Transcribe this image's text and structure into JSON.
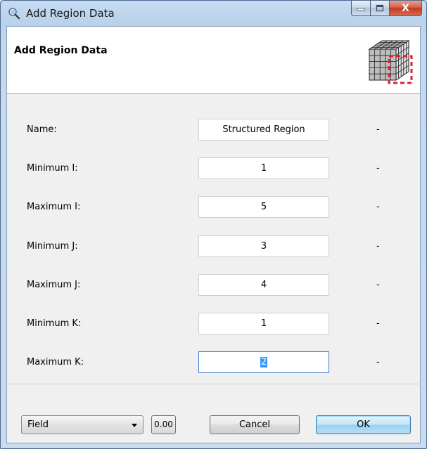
{
  "window": {
    "title": "Add Region Data",
    "icon": "app-magnifier-icon",
    "minimize_glyph": "—",
    "maximize_glyph": "▫",
    "close_glyph": "X"
  },
  "banner": {
    "heading": "Add Region Data",
    "image": "structured-grid-cube-icon"
  },
  "form": {
    "rows": [
      {
        "label": "Name:",
        "value": "Structured Region",
        "suffix": "-"
      },
      {
        "label": "Minimum I:",
        "value": "1",
        "suffix": "-"
      },
      {
        "label": "Maximum I:",
        "value": "5",
        "suffix": "-"
      },
      {
        "label": "Minimum J:",
        "value": "3",
        "suffix": "-"
      },
      {
        "label": "Maximum J:",
        "value": "4",
        "suffix": "-"
      },
      {
        "label": "Minimum K:",
        "value": "1",
        "suffix": "-"
      },
      {
        "label": "Maximum K:",
        "value": "2",
        "suffix": "-"
      }
    ]
  },
  "footer": {
    "mode_select": "Field",
    "value_button": "0.00",
    "cancel_label": "Cancel",
    "ok_label": "OK"
  },
  "colors": {
    "selection": "#3399ff",
    "close_button": "#c13a22",
    "ok_border": "#3c7fb1"
  }
}
